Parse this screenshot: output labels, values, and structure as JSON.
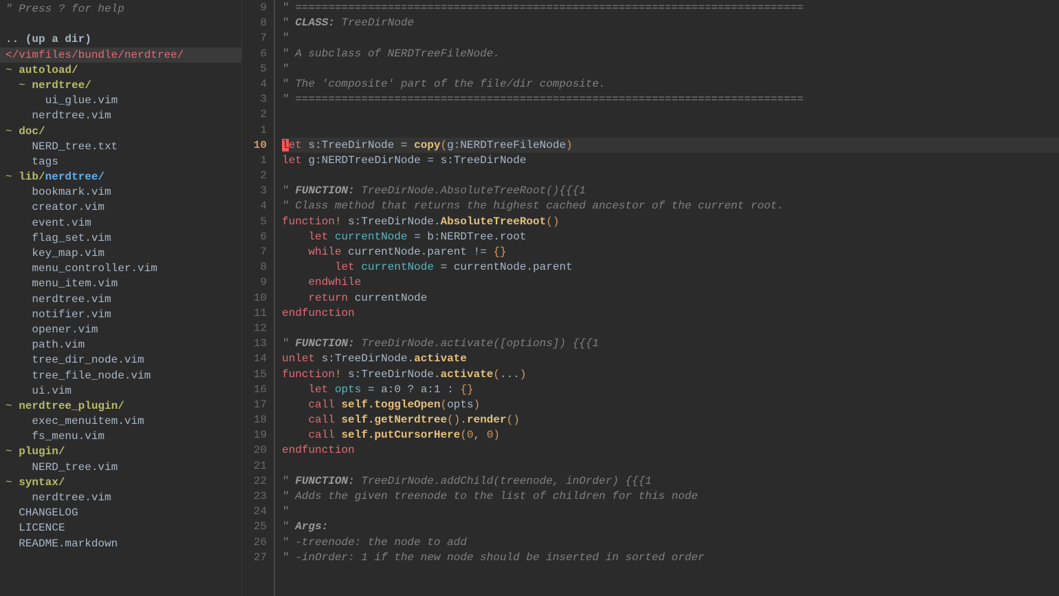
{
  "sidebar": {
    "help": "\" Press ? for help",
    "updir": ".. (up a dir)",
    "path": "</vimfiles/bundle/nerdtree/",
    "items": [
      {
        "indent": 0,
        "type": "dir",
        "label": "autoload/",
        "prefix": "~ "
      },
      {
        "indent": 1,
        "type": "dir",
        "label": "nerdtree/",
        "prefix": "~ "
      },
      {
        "indent": 2,
        "type": "file",
        "label": "ui_glue.vim"
      },
      {
        "indent": 1,
        "type": "file",
        "label": "nerdtree.vim"
      },
      {
        "indent": 0,
        "type": "dir",
        "label": "doc/",
        "prefix": "~ "
      },
      {
        "indent": 1,
        "type": "file",
        "label": "NERD_tree.txt"
      },
      {
        "indent": 1,
        "type": "file",
        "label": "tags"
      },
      {
        "indent": 0,
        "type": "dirx",
        "label": "nerdtree/",
        "prefix": "~ ",
        "pre": "lib/"
      },
      {
        "indent": 1,
        "type": "file",
        "label": "bookmark.vim"
      },
      {
        "indent": 1,
        "type": "file",
        "label": "creator.vim"
      },
      {
        "indent": 1,
        "type": "file",
        "label": "event.vim"
      },
      {
        "indent": 1,
        "type": "file",
        "label": "flag_set.vim"
      },
      {
        "indent": 1,
        "type": "file",
        "label": "key_map.vim"
      },
      {
        "indent": 1,
        "type": "file",
        "label": "menu_controller.vim"
      },
      {
        "indent": 1,
        "type": "file",
        "label": "menu_item.vim"
      },
      {
        "indent": 1,
        "type": "file",
        "label": "nerdtree.vim"
      },
      {
        "indent": 1,
        "type": "file",
        "label": "notifier.vim"
      },
      {
        "indent": 1,
        "type": "file",
        "label": "opener.vim"
      },
      {
        "indent": 1,
        "type": "file",
        "label": "path.vim"
      },
      {
        "indent": 1,
        "type": "file",
        "label": "tree_dir_node.vim"
      },
      {
        "indent": 1,
        "type": "file",
        "label": "tree_file_node.vim"
      },
      {
        "indent": 1,
        "type": "file",
        "label": "ui.vim"
      },
      {
        "indent": 0,
        "type": "dir",
        "label": "nerdtree_plugin/",
        "prefix": "~ "
      },
      {
        "indent": 1,
        "type": "file",
        "label": "exec_menuitem.vim"
      },
      {
        "indent": 1,
        "type": "file",
        "label": "fs_menu.vim"
      },
      {
        "indent": 0,
        "type": "dir",
        "label": "plugin/",
        "prefix": "~ "
      },
      {
        "indent": 1,
        "type": "file",
        "label": "NERD_tree.vim"
      },
      {
        "indent": 0,
        "type": "dir",
        "label": "syntax/",
        "prefix": "~ "
      },
      {
        "indent": 1,
        "type": "file",
        "label": "nerdtree.vim"
      },
      {
        "indent": 0,
        "type": "file",
        "label": "CHANGELOG"
      },
      {
        "indent": 0,
        "type": "file",
        "label": "LICENCE"
      },
      {
        "indent": 0,
        "type": "file",
        "label": "README.markdown"
      }
    ]
  },
  "editor": {
    "cursor_char": "l",
    "lines": [
      {
        "n": "9",
        "t": "comment",
        "text": "\" ============================================================================="
      },
      {
        "n": "8",
        "t": "comment_bold",
        "pre": "\" ",
        "bold": "CLASS:",
        "rest": " TreeDirNode"
      },
      {
        "n": "7",
        "t": "comment",
        "text": "\" \""
      },
      {
        "n": "6",
        "t": "comment",
        "text": "\" A subclass of NERDTreeFileNode."
      },
      {
        "n": "5",
        "t": "comment",
        "text": "\" \""
      },
      {
        "n": "4",
        "t": "comment",
        "text": "\" The 'composite' part of the file/dir composite."
      },
      {
        "n": "3",
        "t": "comment",
        "text": "\" ============================================================================="
      },
      {
        "n": "2",
        "t": "blank",
        "text": ""
      },
      {
        "n": "1",
        "t": "blank",
        "text": ""
      },
      {
        "n": "10",
        "t": "cursor",
        "html": "<span class='cursor-block'>l</span><span class='kw'>et</span> <span class='id'>s:TreeDirNode</span> <span class='op'>=</span> <span class='fn'>copy</span><span class='paren'>(</span><span class='id'>g:NERDTreeFileNode</span><span class='paren'>)</span>"
      },
      {
        "n": "1",
        "t": "code",
        "html": "<span class='kw'>let</span> <span class='id'>g:NERDTreeDirNode</span> <span class='op'>=</span> <span class='id'>s:TreeDirNode</span>"
      },
      {
        "n": "2",
        "t": "blank",
        "text": ""
      },
      {
        "n": "3",
        "t": "comment_bold",
        "pre": "\" ",
        "bold": "FUNCTION:",
        "rest": " TreeDirNode.AbsoluteTreeRoot(){{{1"
      },
      {
        "n": "4",
        "t": "comment",
        "text": "\" Class method that returns the highest cached ancestor of the current root."
      },
      {
        "n": "5",
        "t": "code",
        "html": "<span class='kw'>function</span><span class='kw2'>!</span> <span class='id'>s:TreeDirNode</span><span class='op'>.</span><span class='fn'>AbsoluteTreeRoot</span><span class='paren'>()</span>"
      },
      {
        "n": "6",
        "t": "code",
        "html": "    <span class='kw'>let</span> <span class='var'>currentNode</span> <span class='op'>=</span> <span class='id'>b:NERDTree</span><span class='op'>.</span><span class='id'>root</span>"
      },
      {
        "n": "7",
        "t": "code",
        "html": "    <span class='kw'>while</span> <span class='id'>currentNode.parent</span> <span class='op'>!=</span> <span class='paren'>{}</span>"
      },
      {
        "n": "8",
        "t": "code",
        "html": "        <span class='kw'>let</span> <span class='var'>currentNode</span> <span class='op'>=</span> <span class='id'>currentNode.parent</span>"
      },
      {
        "n": "9",
        "t": "code",
        "html": "    <span class='kw'>endwhile</span>"
      },
      {
        "n": "10",
        "t": "code",
        "html": "    <span class='kw'>return</span> <span class='id'>currentNode</span>"
      },
      {
        "n": "11",
        "t": "code",
        "html": "<span class='kw'>endfunction</span>"
      },
      {
        "n": "12",
        "t": "blank",
        "text": ""
      },
      {
        "n": "13",
        "t": "comment_bold",
        "pre": "\" ",
        "bold": "FUNCTION:",
        "rest": " TreeDirNode.activate([options]) {{{1"
      },
      {
        "n": "14",
        "t": "code",
        "html": "<span class='kw'>unlet</span> <span class='id'>s:TreeDirNode</span><span class='op'>.</span><span class='fn'>activate</span>"
      },
      {
        "n": "15",
        "t": "code",
        "html": "<span class='kw'>function</span><span class='kw2'>!</span> <span class='id'>s:TreeDirNode</span><span class='op'>.</span><span class='fn'>activate</span><span class='paren'>(</span><span class='op'>...</span><span class='paren'>)</span>"
      },
      {
        "n": "16",
        "t": "code",
        "html": "    <span class='kw'>let</span> <span class='var'>opts</span> <span class='op'>=</span> <span class='id'>a:0</span> <span class='op'>?</span> <span class='id'>a:1</span> <span class='op'>:</span> <span class='paren'>{}</span>"
      },
      {
        "n": "17",
        "t": "code",
        "html": "    <span class='kw'>call</span> <span class='fn'>self.toggleOpen</span><span class='paren'>(</span><span class='id'>opts</span><span class='paren'>)</span>"
      },
      {
        "n": "18",
        "t": "code",
        "html": "    <span class='kw'>call</span> <span class='fn'>self.getNerdtree</span><span class='paren'>()</span><span class='op'>.</span><span class='fn'>render</span><span class='paren'>()</span>"
      },
      {
        "n": "19",
        "t": "code",
        "html": "    <span class='kw'>call</span> <span class='fn'>self.putCursorHere</span><span class='paren'>(</span><span class='num'>0</span><span class='op'>,</span> <span class='num'>0</span><span class='paren'>)</span>"
      },
      {
        "n": "20",
        "t": "code",
        "html": "<span class='kw'>endfunction</span>"
      },
      {
        "n": "21",
        "t": "blank",
        "text": ""
      },
      {
        "n": "22",
        "t": "comment_bold",
        "pre": "\" ",
        "bold": "FUNCTION:",
        "rest": " TreeDirNode.addChild(treenode, inOrder) {{{1"
      },
      {
        "n": "23",
        "t": "comment",
        "text": "\" Adds the given treenode to the list of children for this node"
      },
      {
        "n": "24",
        "t": "comment",
        "text": "\" \""
      },
      {
        "n": "25",
        "t": "comment_bold",
        "pre": "\" ",
        "bold": "Args:",
        "rest": ""
      },
      {
        "n": "26",
        "t": "comment",
        "text": "\" -treenode: the node to add"
      },
      {
        "n": "27",
        "t": "comment",
        "text": "\" -inOrder: 1 if the new node should be inserted in sorted order"
      }
    ]
  }
}
